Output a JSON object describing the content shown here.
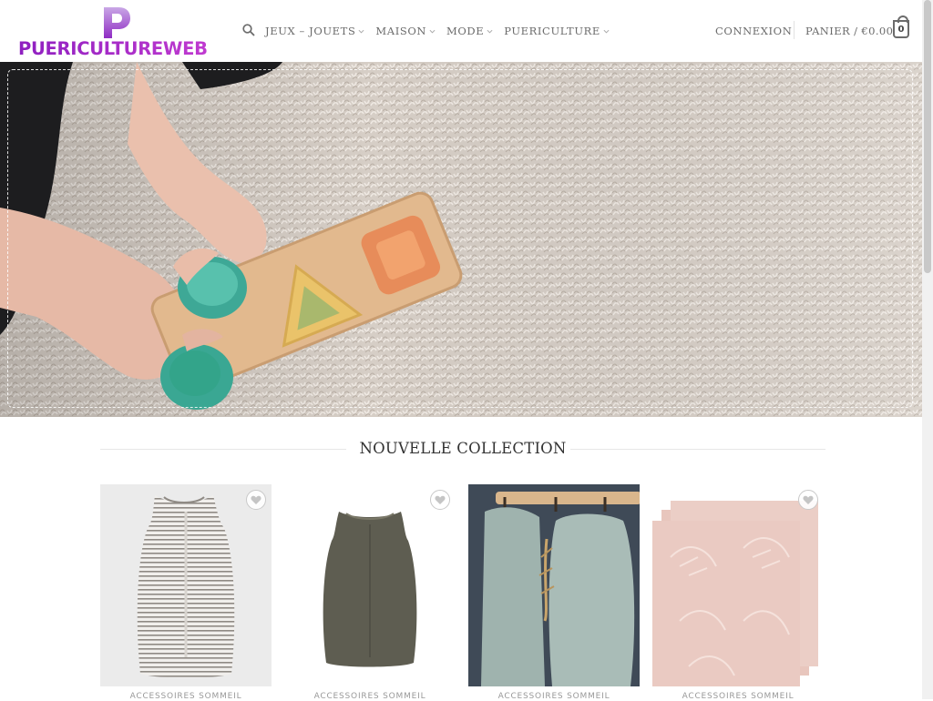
{
  "brand": {
    "logo_text": "PUERICULTUREWEB",
    "logo_mark": "P",
    "color": "#9a22c4"
  },
  "header": {
    "search_icon": "search-icon",
    "nav": [
      {
        "label": "JEUX – JOUETS"
      },
      {
        "label": "MAISON"
      },
      {
        "label": "MODE"
      },
      {
        "label": "PUERICULTURE"
      }
    ],
    "login": "CONNEXION",
    "cart_label": "PANIER / €0.00",
    "cart_count": "0"
  },
  "hero": {
    "description_icon": "hero-image"
  },
  "collection": {
    "title": "NOUVELLE COLLECTION",
    "products": [
      {
        "category": "ACCESSOIRES SOMMEIL"
      },
      {
        "category": "ACCESSOIRES SOMMEIL"
      },
      {
        "category": "ACCESSOIRES SOMMEIL"
      },
      {
        "category": "ACCESSOIRES SOMMEIL"
      }
    ]
  }
}
